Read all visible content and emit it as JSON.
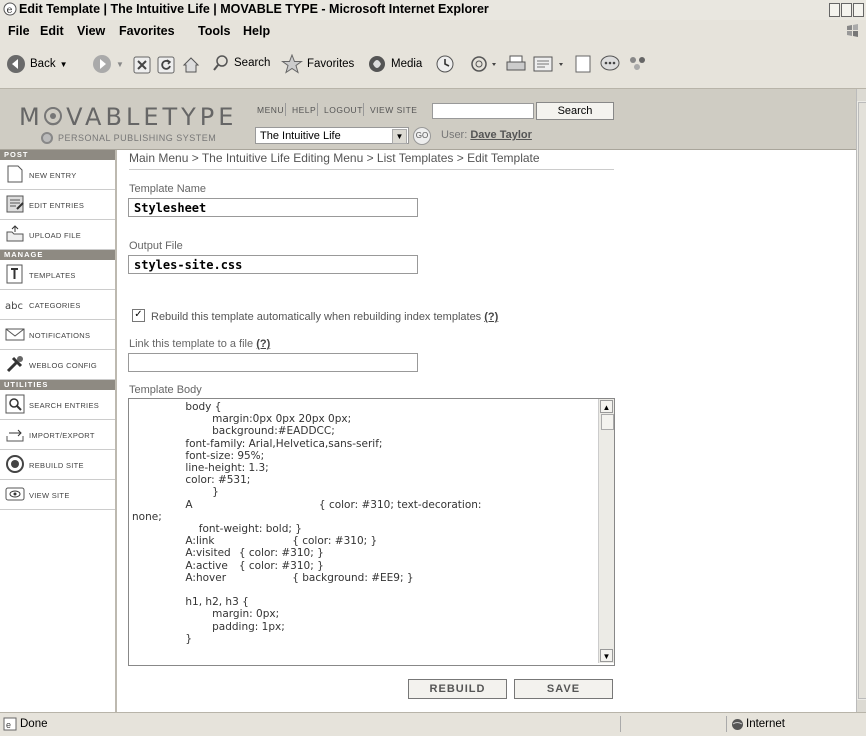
{
  "window": {
    "title": "Edit Template | The Intuitive Life | MOVABLE TYPE - Microsoft Internet Explorer"
  },
  "menubar": {
    "items": [
      "File",
      "Edit",
      "View",
      "Favorites",
      "Tools",
      "Help"
    ]
  },
  "toolbar": {
    "back": "Back",
    "search": "Search",
    "favorites": "Favorites",
    "media": "Media"
  },
  "mt_header": {
    "logo_text": "MOVABLETYPE",
    "tagline": "PERSONAL PUBLISHING SYSTEM",
    "nav": [
      "MENU",
      "HELP",
      "LOGOUT",
      "VIEW SITE"
    ],
    "search_button": "Search",
    "search_value": "",
    "blog_select": "The Intuitive Life",
    "go_label": "GO",
    "user_label": "User:",
    "user_name": "Dave Taylor"
  },
  "sidebar": {
    "sections": [
      "POST",
      "MANAGE",
      "UTILITIES"
    ],
    "items": [
      {
        "label": "NEW ENTRY",
        "icon": "new-entry-icon"
      },
      {
        "label": "EDIT ENTRIES",
        "icon": "edit-entries-icon"
      },
      {
        "label": "UPLOAD FILE",
        "icon": "upload-file-icon"
      },
      {
        "label": "TEMPLATES",
        "icon": "templates-icon"
      },
      {
        "label": "CATEGORIES",
        "icon": "categories-icon"
      },
      {
        "label": "NOTIFICATIONS",
        "icon": "notifications-icon"
      },
      {
        "label": "WEBLOG CONFIG",
        "icon": "weblog-config-icon"
      },
      {
        "label": "SEARCH ENTRIES",
        "icon": "search-entries-icon"
      },
      {
        "label": "IMPORT/EXPORT",
        "icon": "import-export-icon"
      },
      {
        "label": "REBUILD SITE",
        "icon": "rebuild-site-icon"
      },
      {
        "label": "VIEW SITE",
        "icon": "view-site-icon"
      }
    ]
  },
  "main": {
    "breadcrumb": "Main Menu > The Intuitive Life Editing Menu > List Templates > Edit Template",
    "template_name_label": "Template Name",
    "template_name_value": "Stylesheet",
    "output_file_label": "Output File",
    "output_file_value": "styles-site.css",
    "rebuild_checked": true,
    "rebuild_label": "Rebuild this template automatically when rebuilding index templates",
    "help_marker": "(?)",
    "link_label": "Link this template to a file",
    "link_value": "",
    "body_label": "Template Body",
    "body_text": "\t\tbody {\n\t\t\tmargin:0px 0px 20px 0px;\n\t\t\tbackground:#EADDCC;\n\t\tfont-family: Arial,Helvetica,sans-serif;\n\t\tfont-size: 95%;\n\t\tline-height: 1.3;\n\t\tcolor: #531;\n\t\t\t}\n\t\tA\t\t\t\t\t{ color: #310; text-decoration:\nnone;\n\t\t    font-weight: bold; }\n\t\tA:link\t\t\t{ color: #310; }\n\t\tA:visited\t{ color: #310; }\n\t\tA:active\t{ color: #310; }\n\t\tA:hover\t\t\t{ background: #EE9; }\n\n\t\th1, h2, h3 {\n\t\t\tmargin: 0px;\n\t\t\tpadding: 1px;\n\t\t}",
    "rebuild_button": "REBUILD",
    "save_button": "SAVE"
  },
  "statusbar": {
    "status": "Done",
    "zone": "Internet"
  },
  "colors": {
    "chrome": "#e6e3db",
    "mt_header": "#cfccc3",
    "section_bar": "#8e8a82"
  }
}
